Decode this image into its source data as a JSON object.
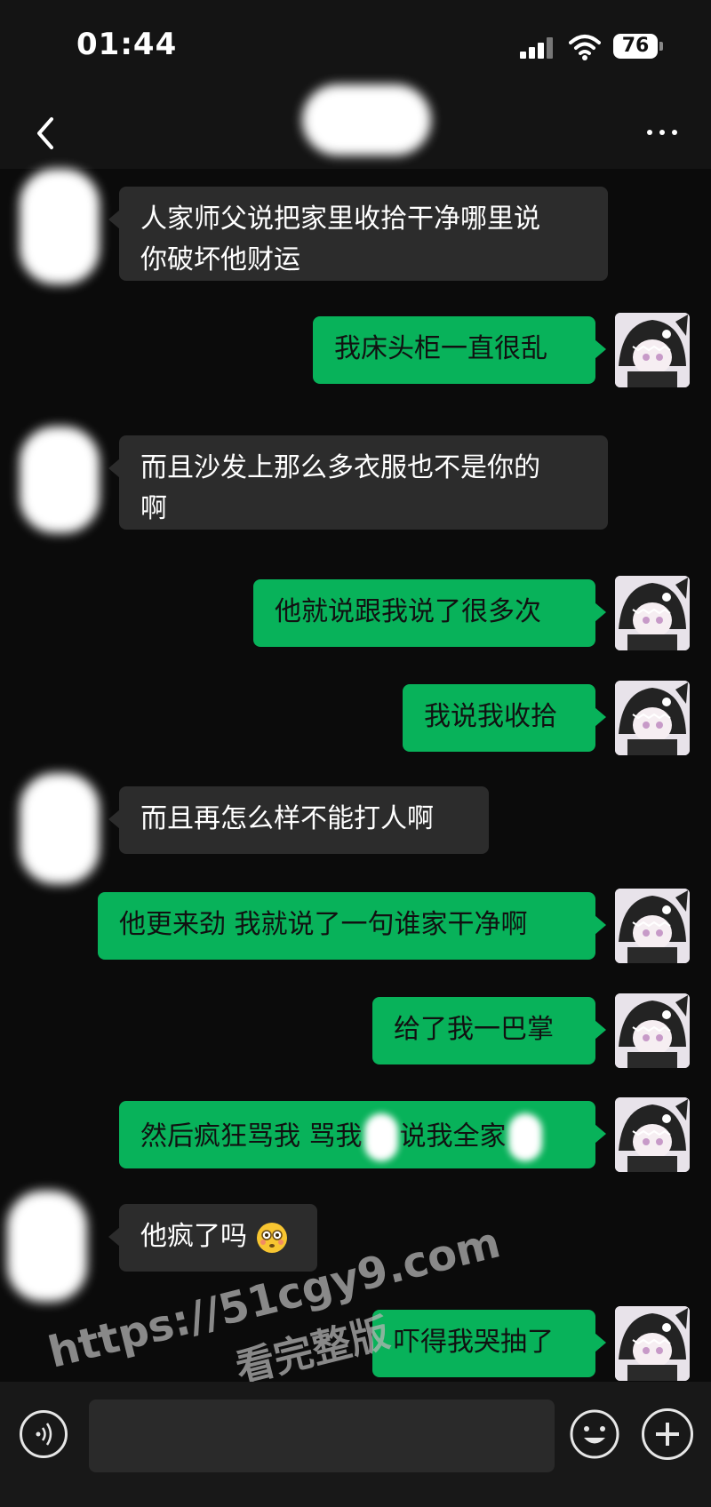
{
  "status": {
    "time": "01:44",
    "battery": "76",
    "icons": [
      "cellular-signal-icon",
      "wifi-icon",
      "battery-icon"
    ]
  },
  "navbar": {
    "back_icon": "chevron-left-icon",
    "more_icon": "more-dots-icon"
  },
  "messages": [
    {
      "side": "recv",
      "text_line1": "人家师父说把家里收拾干净哪里说",
      "text_line2": "你破坏他财运"
    },
    {
      "side": "sent",
      "text": "我床头柜一直很乱"
    },
    {
      "side": "recv",
      "text_line1": "而且沙发上那么多衣服也不是你的",
      "text_line2": "啊"
    },
    {
      "side": "sent",
      "text": "他就说跟我说了很多次"
    },
    {
      "side": "sent",
      "text": "我说我收拾"
    },
    {
      "side": "recv",
      "text": "而且再怎么样不能打人啊"
    },
    {
      "side": "sent",
      "text": "他更来劲 我就说了一句谁家干净啊"
    },
    {
      "side": "sent",
      "text": "给了我一巴掌"
    },
    {
      "side": "sent",
      "text_a": "然后疯狂骂我 骂我",
      "text_b": "说我全家"
    },
    {
      "side": "recv",
      "text": "他疯了吗"
    },
    {
      "side": "sent",
      "text": "吓得我哭抽了"
    }
  ],
  "watermark": {
    "line1": "https://51cgy9.com",
    "line2": "看完整版"
  },
  "input": {
    "value": "",
    "voice_icon": "voice-icon",
    "emoji_icon": "emoji-icon",
    "plus_icon": "plus-icon"
  },
  "colors": {
    "sent_bubble": "#08b25a",
    "recv_bubble": "#2c2c2c",
    "background": "#0b0b0b"
  }
}
